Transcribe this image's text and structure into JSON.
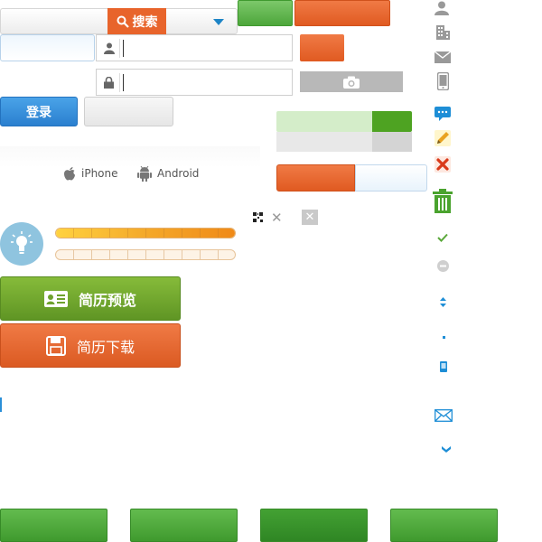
{
  "search": {
    "button_label": "搜索"
  },
  "login": {
    "button_label": "登录"
  },
  "platforms": [
    {
      "label": "iPhone"
    },
    {
      "label": "Android"
    }
  ],
  "resume": {
    "preview_label": "简历预览",
    "download_label": "简历下载"
  },
  "progress": {
    "yellow_bar_fill": 1.0,
    "outline_bar_fill": 0.0,
    "green_segment_fill": 0.29
  },
  "colors": {
    "accent_orange": "#e8642b",
    "accent_green": "#4ea322",
    "accent_blue": "#2a7fcf"
  },
  "sidebar_icons": [
    "user-icon",
    "building-icon",
    "mail-icon",
    "phone-icon",
    "chat-icon",
    "pencil-icon",
    "red-x-icon",
    "trash-icon",
    "check-icon",
    "minus-circle-icon",
    "sort-arrows-icon",
    "dot-icon",
    "small-phone-icon",
    "envelope-outline-icon",
    "chevron-down-icon"
  ]
}
